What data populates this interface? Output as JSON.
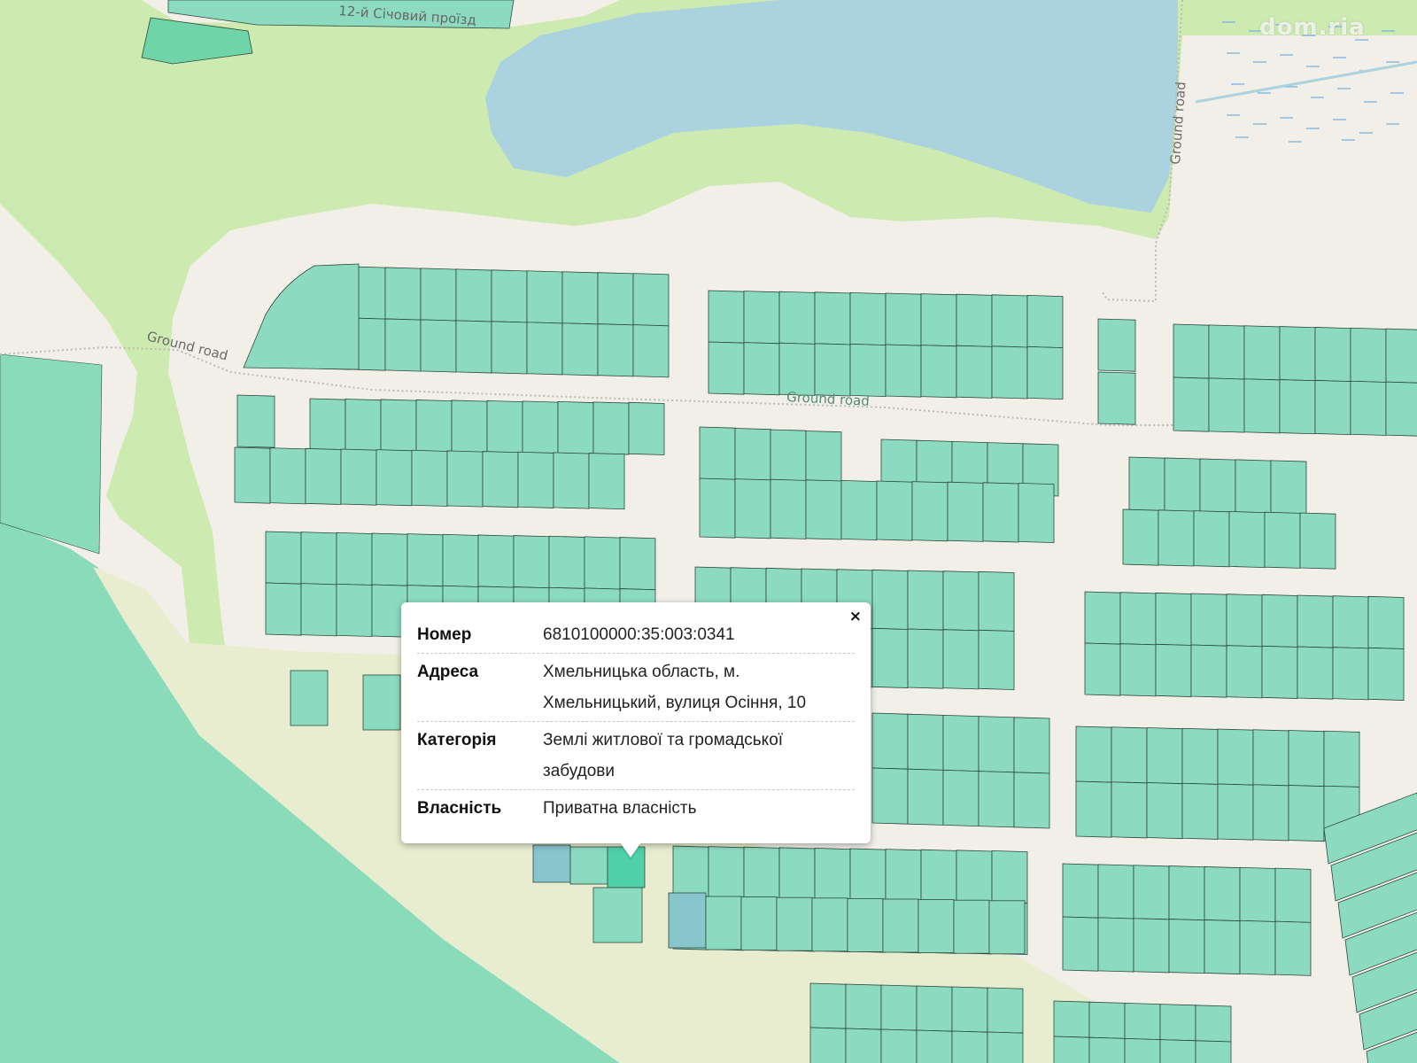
{
  "map": {
    "road_labels": [
      "Ground road",
      "Ground road",
      "Ground road"
    ],
    "street_label": "12-й Січовий проїзд",
    "watermark": "dom.ria",
    "colors": {
      "background": "#f2efe9",
      "park": "#cdeab0",
      "water": "#aad3df",
      "parcel": "#8cdbc0",
      "parcel_stroke": "#2d4a3e",
      "selected_parcel": "#4fd0a8",
      "blue_parcel": "#88c5cc",
      "big_area": "#8adbb9",
      "sand": "#e9edcf"
    }
  },
  "popup": {
    "close_symbol": "×",
    "rows": [
      {
        "label": "Номер",
        "value": "6810100000:35:003:0341"
      },
      {
        "label": "Адреса",
        "value": "Хмельницька область, м. Хмельницький, вулиця Осіння, 10"
      },
      {
        "label": "Категорія",
        "value": "Землі житлової та громадської забудови"
      },
      {
        "label": "Власність",
        "value": "Приватна власність"
      }
    ]
  }
}
